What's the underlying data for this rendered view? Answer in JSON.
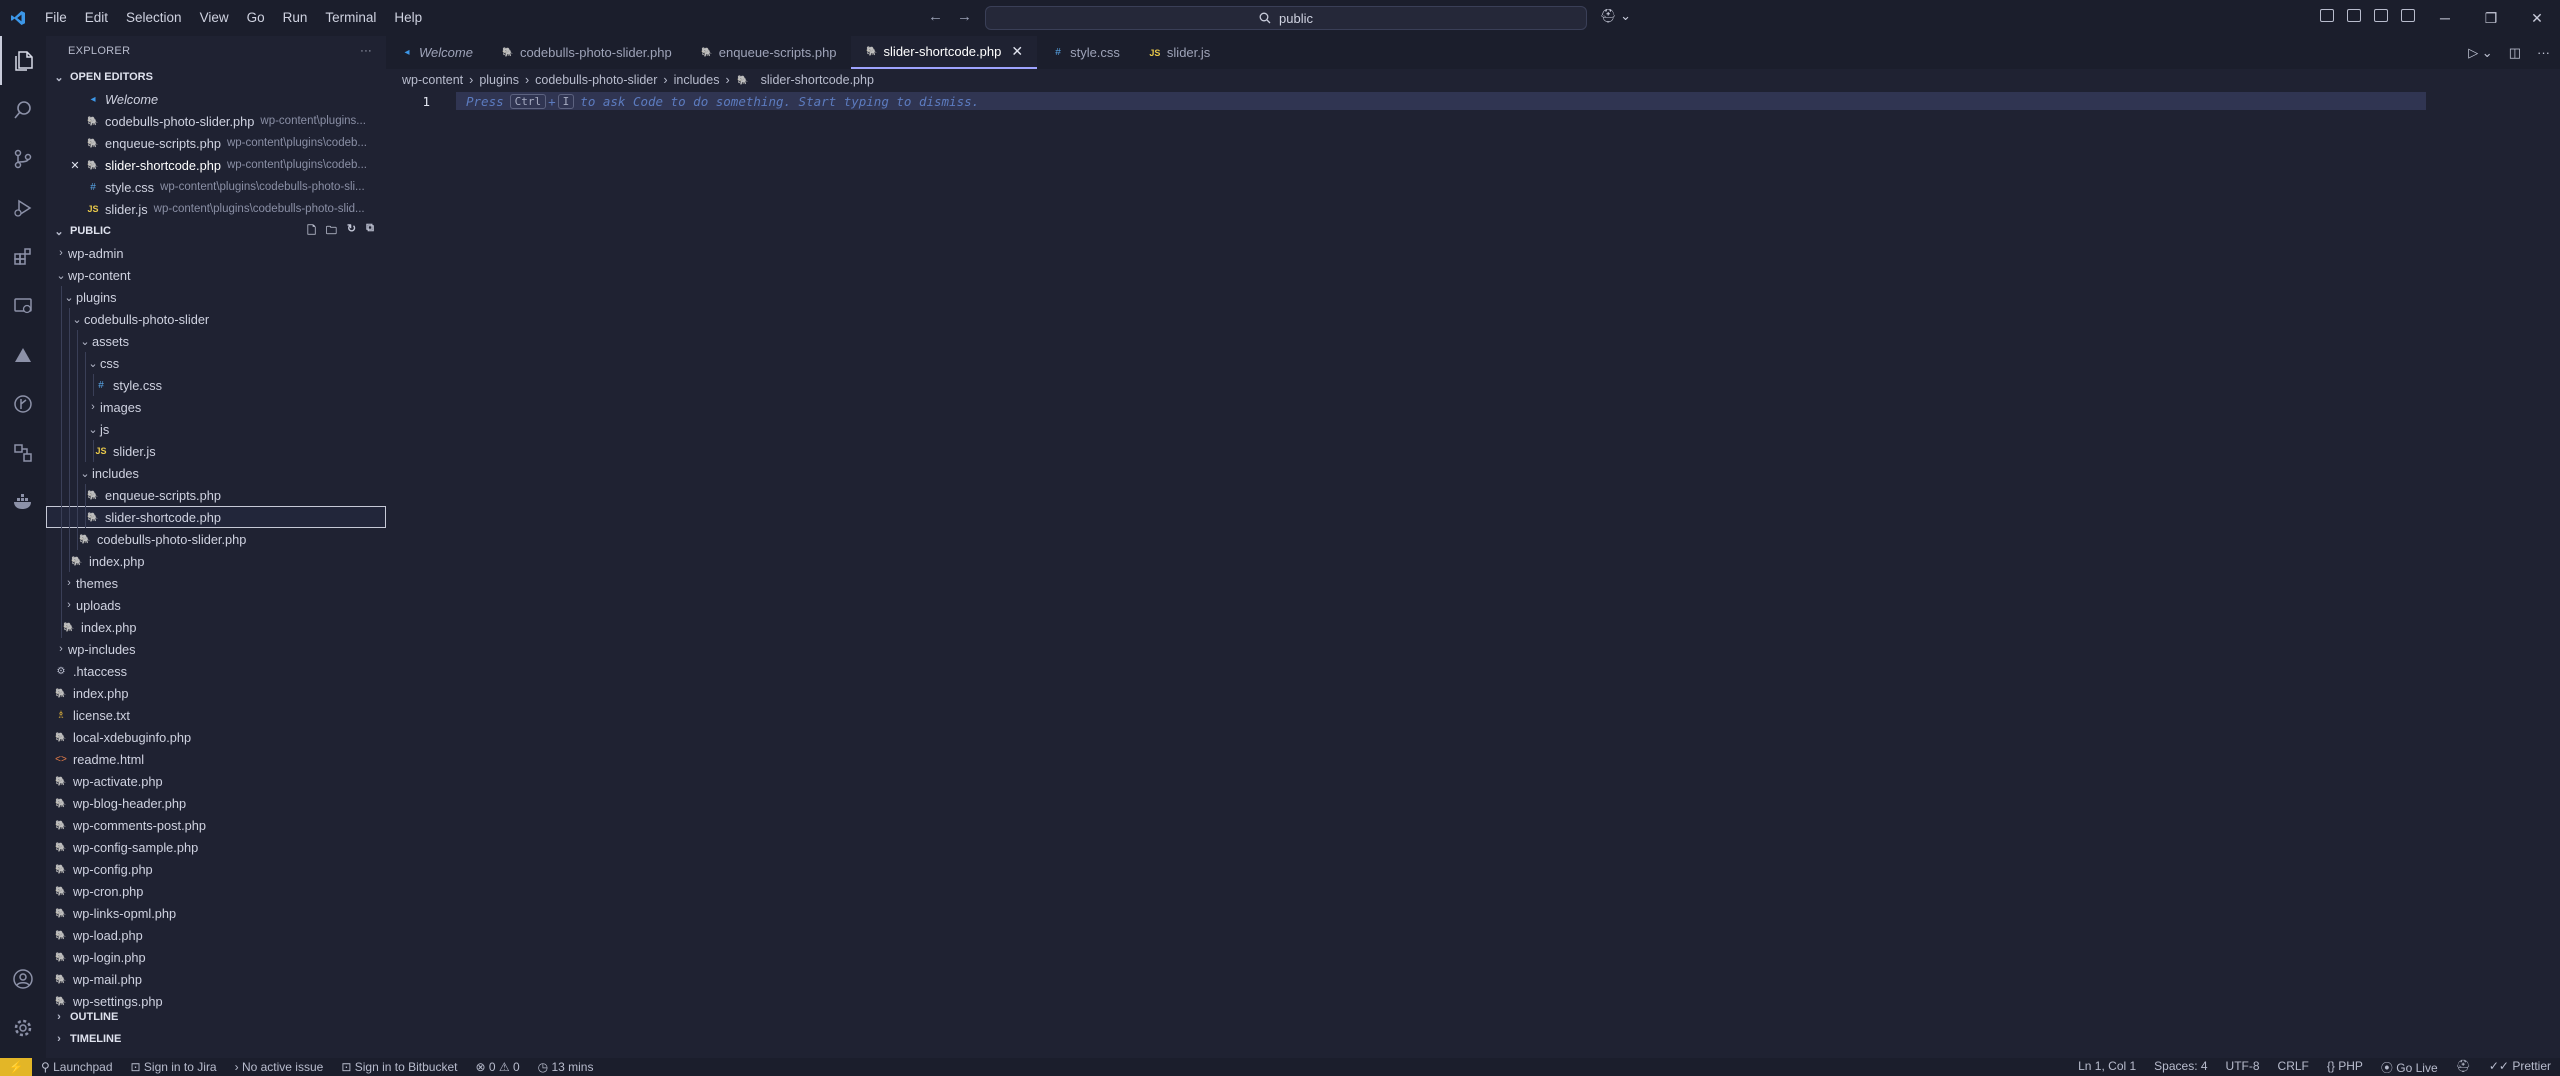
{
  "menu": [
    "File",
    "Edit",
    "Selection",
    "View",
    "Go",
    "Run",
    "Terminal",
    "Help"
  ],
  "search": {
    "text": "public"
  },
  "explorer": {
    "title": "EXPLORER",
    "open_editors_title": "OPEN EDITORS",
    "public_title": "PUBLIC",
    "outline": "OUTLINE",
    "timeline": "TIMELINE"
  },
  "open_editors": [
    {
      "name": "Welcome",
      "desc": "",
      "icon": "vscode-icon"
    },
    {
      "name": "codebulls-photo-slider.php",
      "desc": "wp-content\\plugins...",
      "icon": "php-icon"
    },
    {
      "name": "enqueue-scripts.php",
      "desc": "wp-content\\plugins\\codeb...",
      "icon": "php-icon"
    },
    {
      "name": "slider-shortcode.php",
      "desc": "wp-content\\plugins\\codeb...",
      "icon": "php-icon"
    },
    {
      "name": "style.css",
      "desc": "wp-content\\plugins\\codebulls-photo-sli...",
      "icon": "css-icon"
    },
    {
      "name": "slider.js",
      "desc": "wp-content\\plugins\\codebulls-photo-slid...",
      "icon": "js-icon"
    }
  ],
  "tree": [
    {
      "name": "wp-admin",
      "kind": "folder",
      "open": false,
      "depth": 0
    },
    {
      "name": "wp-content",
      "kind": "folder",
      "open": true,
      "depth": 0
    },
    {
      "name": "plugins",
      "kind": "folder",
      "open": true,
      "depth": 1
    },
    {
      "name": "codebulls-photo-slider",
      "kind": "folder",
      "open": true,
      "depth": 2
    },
    {
      "name": "assets",
      "kind": "folder",
      "open": true,
      "depth": 3
    },
    {
      "name": "css",
      "kind": "folder",
      "open": true,
      "depth": 4
    },
    {
      "name": "style.css",
      "kind": "css",
      "depth": 5
    },
    {
      "name": "images",
      "kind": "folder",
      "open": false,
      "depth": 4
    },
    {
      "name": "js",
      "kind": "folder",
      "open": true,
      "depth": 4
    },
    {
      "name": "slider.js",
      "kind": "js",
      "depth": 5
    },
    {
      "name": "includes",
      "kind": "folder",
      "open": true,
      "depth": 3
    },
    {
      "name": "enqueue-scripts.php",
      "kind": "php",
      "depth": 4
    },
    {
      "name": "slider-shortcode.php",
      "kind": "php",
      "depth": 4,
      "selected": true
    },
    {
      "name": "codebulls-photo-slider.php",
      "kind": "php",
      "depth": 3
    },
    {
      "name": "index.php",
      "kind": "php",
      "depth": 2
    },
    {
      "name": "themes",
      "kind": "folder",
      "open": false,
      "depth": 1
    },
    {
      "name": "uploads",
      "kind": "folder",
      "open": false,
      "depth": 1
    },
    {
      "name": "index.php",
      "kind": "php",
      "depth": 1
    },
    {
      "name": "wp-includes",
      "kind": "folder",
      "open": false,
      "depth": 0
    },
    {
      "name": ".htaccess",
      "kind": "gear",
      "depth": 0
    },
    {
      "name": "index.php",
      "kind": "php",
      "depth": 0
    },
    {
      "name": "license.txt",
      "kind": "lic",
      "depth": 0
    },
    {
      "name": "local-xdebuginfo.php",
      "kind": "php",
      "depth": 0
    },
    {
      "name": "readme.html",
      "kind": "html",
      "depth": 0
    },
    {
      "name": "wp-activate.php",
      "kind": "php",
      "depth": 0
    },
    {
      "name": "wp-blog-header.php",
      "kind": "php",
      "depth": 0
    },
    {
      "name": "wp-comments-post.php",
      "kind": "php",
      "depth": 0
    },
    {
      "name": "wp-config-sample.php",
      "kind": "php",
      "depth": 0
    },
    {
      "name": "wp-config.php",
      "kind": "php",
      "depth": 0
    },
    {
      "name": "wp-cron.php",
      "kind": "php",
      "depth": 0
    },
    {
      "name": "wp-links-opml.php",
      "kind": "php",
      "depth": 0
    },
    {
      "name": "wp-load.php",
      "kind": "php",
      "depth": 0
    },
    {
      "name": "wp-login.php",
      "kind": "php",
      "depth": 0
    },
    {
      "name": "wp-mail.php",
      "kind": "php",
      "depth": 0
    },
    {
      "name": "wp-settings.php",
      "kind": "php",
      "depth": 0
    }
  ],
  "tabs": [
    {
      "label": "Welcome",
      "icon": "vscode-icon",
      "active": false,
      "italic": true
    },
    {
      "label": "codebulls-photo-slider.php",
      "icon": "php-icon",
      "active": false
    },
    {
      "label": "enqueue-scripts.php",
      "icon": "php-icon",
      "active": false
    },
    {
      "label": "slider-shortcode.php",
      "icon": "php-icon",
      "active": true
    },
    {
      "label": "style.css",
      "icon": "css-icon",
      "active": false
    },
    {
      "label": "slider.js",
      "icon": "js-icon",
      "active": false
    }
  ],
  "breadcrumb": [
    "wp-content",
    "plugins",
    "codebulls-photo-slider",
    "includes",
    "slider-shortcode.php"
  ],
  "editor": {
    "line_number": "1",
    "hint_press": "Press",
    "hint_key1": "Ctrl",
    "hint_plus": "+",
    "hint_key2": "I",
    "hint_rest": "to ask Code to do something. Start typing to dismiss."
  },
  "status": {
    "left": [
      "Launchpad",
      "Sign in to Jira",
      "No active issue",
      "Sign in to Bitbucket",
      "⊗ 0 ⚠ 0",
      "13 mins"
    ],
    "right": [
      "Ln 1, Col 1",
      "Spaces: 4",
      "UTF-8",
      "CRLF",
      "{} PHP",
      "Go Live",
      "Prettier"
    ]
  },
  "colors": {
    "accent": "#9ea3ff",
    "remote_bg": "#e3b627",
    "bg": "#1f2232"
  }
}
